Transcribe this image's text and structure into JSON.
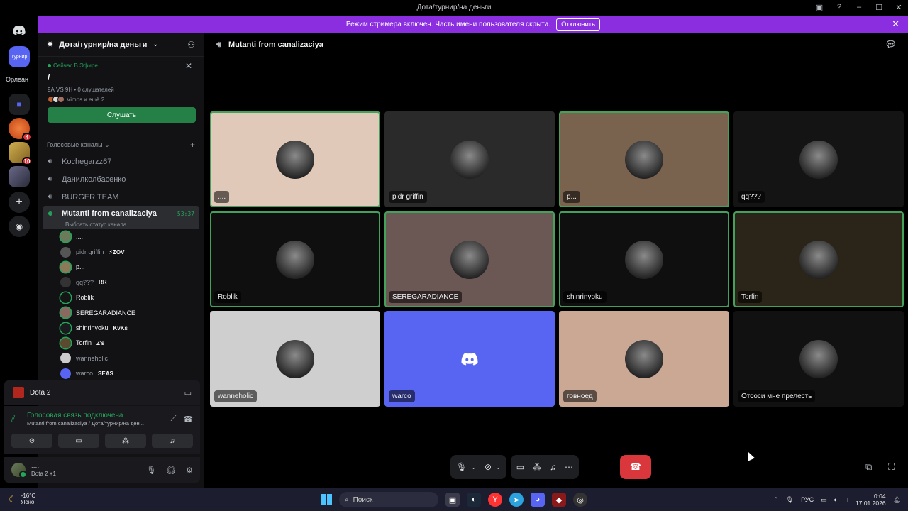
{
  "window": {
    "title": "Дота/турнир/на деньги"
  },
  "rail": {
    "servers": [
      {
        "label": "Турнир",
        "badge": ""
      },
      {
        "label": "",
        "badge": "4"
      },
      {
        "label": "",
        "badge": "10"
      }
    ],
    "folder_label": "Орлеан"
  },
  "banner": {
    "text": "Режим стримера включен. Часть имени пользователя скрыта.",
    "button": "Отключить"
  },
  "server": {
    "name": "Дота/турнир/на деньги"
  },
  "stage": {
    "live_label": "Сейчас В Эфире",
    "title": "/",
    "meta": "9А VS 9Н • 0 слушателей",
    "avatars_text": "Vimps и ещё 2",
    "listen_label": "Слушать"
  },
  "voice_category": "Голосовые каналы",
  "voice_channels": [
    {
      "name": "Kochegarzz67"
    },
    {
      "name": "Данилколбасенко"
    },
    {
      "name": "BURGER TEAM"
    }
  ],
  "active_channel": {
    "name": "Mutanti from canalizaciya",
    "timer": "53:37",
    "status": "Выбрать статус канала"
  },
  "voice_users": [
    {
      "name": "....",
      "tag": "",
      "dim": false
    },
    {
      "name": "pidr griffin",
      "tag": "⚡ZOV",
      "dim": true
    },
    {
      "name": "p...",
      "tag": "",
      "dim": false
    },
    {
      "name": "qq???",
      "tag": "RR",
      "dim": true
    },
    {
      "name": "Roblik",
      "tag": "",
      "dim": false
    },
    {
      "name": "SEREGARADIANCE",
      "tag": "",
      "dim": false
    },
    {
      "name": "shinrinyoku",
      "tag": "KvKs",
      "dim": false
    },
    {
      "name": "Torfin",
      "tag": "Z's",
      "dim": false
    },
    {
      "name": "wanneholic",
      "tag": "",
      "dim": true
    },
    {
      "name": "warco",
      "tag": "SEAS",
      "dim": true
    }
  ],
  "gamebar": {
    "game": "Dota 2"
  },
  "voicepanel": {
    "status": "Голосовая связь подключена",
    "path": "Mutanti from canalizaciya / Дота/турнир/на ден..."
  },
  "user": {
    "name": "....",
    "activity": "Dota 2 +1"
  },
  "main": {
    "channel": "Mutanti from canalizaciya"
  },
  "tiles": [
    {
      "name": "....",
      "bg": "#e0c9b9",
      "speaking": true
    },
    {
      "name": "pidr griffin",
      "bg": "#2a2a2a",
      "speaking": false
    },
    {
      "name": "p...",
      "bg": "#7a634e",
      "speaking": true
    },
    {
      "name": "qq???",
      "bg": "#141414",
      "speaking": false
    },
    {
      "name": "Roblik",
      "bg": "#0f0f0f",
      "speaking": true
    },
    {
      "name": "SEREGARADIANCE",
      "bg": "#6b5754",
      "speaking": true
    },
    {
      "name": "shinrinyoku",
      "bg": "#0f0f10",
      "speaking": true
    },
    {
      "name": "Torfin",
      "bg": "#2b2418",
      "speaking": true
    },
    {
      "name": "wanneholic",
      "bg": "#cfcfcf",
      "speaking": false
    },
    {
      "name": "warco",
      "bg": "#5865f2",
      "speaking": false
    },
    {
      "name": "говноед",
      "bg": "#caa894",
      "speaking": false
    },
    {
      "name": "Отсоси мне прелесть",
      "bg": "#111111",
      "speaking": false
    }
  ],
  "taskbar": {
    "temp": "-16°C",
    "weather": "Ясно",
    "search": "Поиск",
    "lang": "РУС",
    "time": "0:04",
    "date": "17.01.2026"
  },
  "colors": {
    "accent": "#5865f2",
    "online": "#23a55a",
    "banner": "#8a2ee0",
    "danger": "#da373c"
  }
}
